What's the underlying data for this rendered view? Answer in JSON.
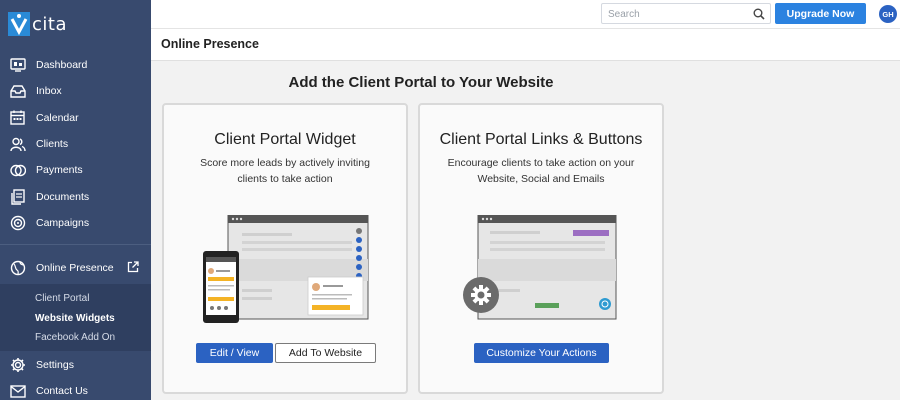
{
  "brand": {
    "name": "cita"
  },
  "colors": {
    "sidebar": "#384a6e",
    "accent": "#2b82e0",
    "primary_button": "#2b62c2"
  },
  "sidebar": {
    "items": [
      {
        "label": "Dashboard",
        "icon": "dashboard-icon"
      },
      {
        "label": "Inbox",
        "icon": "inbox-icon"
      },
      {
        "label": "Calendar",
        "icon": "calendar-icon"
      },
      {
        "label": "Clients",
        "icon": "clients-icon"
      },
      {
        "label": "Payments",
        "icon": "payments-icon"
      },
      {
        "label": "Documents",
        "icon": "documents-icon"
      },
      {
        "label": "Campaigns",
        "icon": "campaigns-icon"
      }
    ],
    "online_presence": {
      "label": "Online Presence",
      "icon": "globe-icon"
    },
    "sub_items": [
      {
        "label": "Client Portal"
      },
      {
        "label": "Website Widgets",
        "active": true
      },
      {
        "label": "Facebook Add On"
      }
    ],
    "bottom_items": [
      {
        "label": "Settings",
        "icon": "gear-icon"
      },
      {
        "label": "Contact Us",
        "icon": "mail-icon"
      }
    ]
  },
  "topbar": {
    "search_placeholder": "Search",
    "upgrade_label": "Upgrade Now",
    "avatar_initials": "GH"
  },
  "page": {
    "title": "Online Presence",
    "heading": "Add the Client Portal to Your Website"
  },
  "cards": [
    {
      "title": "Client Portal Widget",
      "description": "Score more leads by actively inviting clients to take action",
      "buttons": [
        "Edit / View",
        "Add To Website"
      ]
    },
    {
      "title": "Client Portal Links & Buttons",
      "description": "Encourage clients to take action on your Website, Social and Emails",
      "buttons": [
        "Customize Your Actions"
      ]
    }
  ]
}
